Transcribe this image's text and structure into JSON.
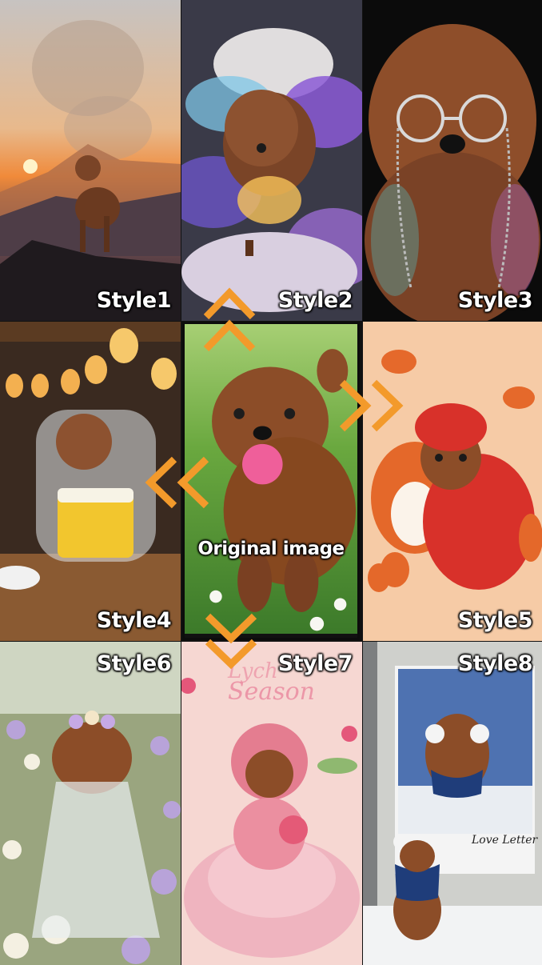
{
  "tiles": {
    "style1": {
      "label": "Style1"
    },
    "style2": {
      "label": "Style2"
    },
    "style3": {
      "label": "Style3"
    },
    "style4": {
      "label": "Style4"
    },
    "style5": {
      "label": "Style5"
    },
    "style6": {
      "label": "Style6"
    },
    "style7": {
      "label": "Style7",
      "overlay_text": "Season",
      "overlay_text_partial": "Lych"
    },
    "style8": {
      "label": "Style8",
      "poster_text": "Love Letter"
    }
  },
  "center": {
    "label": "Original image"
  },
  "colors": {
    "arrow": "#f39a2b",
    "fur": "#8a4a26",
    "grass": "#5a9a3a",
    "sunset": "#f2994a",
    "cloud_purple": "#7b5bc9",
    "fox_orange": "#e4682a",
    "pink": "#f2a7b8"
  },
  "icons": [
    "arrow-up-icon",
    "arrow-right-icon",
    "arrow-left-icon",
    "arrow-down-icon"
  ]
}
